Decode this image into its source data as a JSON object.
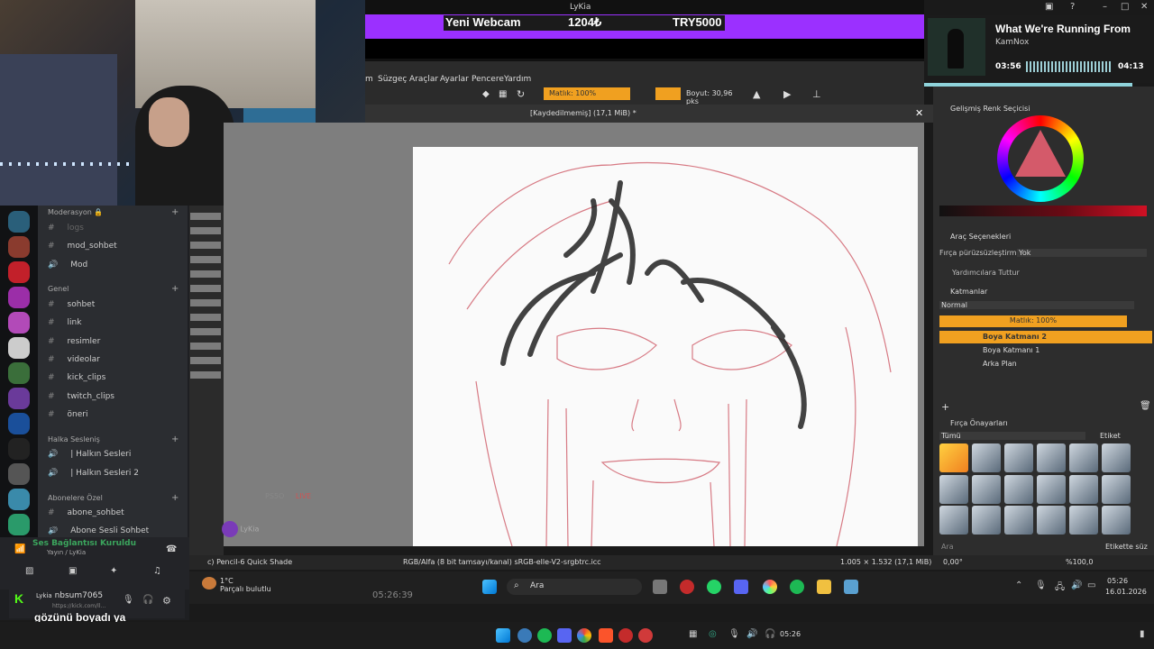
{
  "stream": {
    "streamer": "LyKia",
    "goal_label": "Yeni Webcam",
    "goal_current": "1204₺",
    "goal_target": "TRY5000"
  },
  "spotify": {
    "title": "What We're Running From",
    "artist": "KamNox",
    "time_elapsed": "03:56",
    "time_total": "04:13",
    "progress": 0.93
  },
  "krita": {
    "menu": [
      "Süzgeç",
      "Araçlar",
      "Ayarlar",
      "Pencere",
      "Yardım"
    ],
    "opacity_label": "Matlık: 100%",
    "size_label": "Boyut: 30,96 pks",
    "document_title": "[Kaydedilmemiş]  (17,1 MiB) *",
    "close": "✕",
    "status_brush": "c) Pencil-6 Quick Shade",
    "status_color": "RGB/Alfa (8 bit tamsayı/kanal)  sRGB-elle-V2-srgbtrc.icc",
    "status_size": "1.005 × 1.532 (17,1 MiB)",
    "status_angle": "0,00°",
    "status_zoom": "%100,0",
    "dockers": {
      "color_selector": "Gelişmiş Renk Seçicisi",
      "tool_options": "Araç Seçenekleri",
      "smoothing_label": "Fırça pürüzsüzleştirme:",
      "smoothing_value": "Yok",
      "snap_label": "Yardımcılara Tuttur",
      "layers": "Katmanlar",
      "blend_mode": "Normal",
      "layer_opacity": "Matlık:  100%",
      "layer_list": [
        "Boya Katmanı 2",
        "Boya Katmanı 1",
        "Arka Plan"
      ],
      "brush_presets": "Fırça Önayarları",
      "brush_filter": "Tümü",
      "tag_label": "Etiket",
      "search_placeholder": "Ara",
      "tag_filter": "Etikette süz"
    }
  },
  "discord": {
    "categories": {
      "moderation": "Moderasyon 🔒",
      "general": "Genel",
      "voice": "Halka Sesleniş",
      "subscribers": "Abonelere Özel"
    },
    "channels": {
      "logs": "logs",
      "mod_sohbet": "mod_sohbet",
      "mod": "Mod",
      "sohbet": "sohbet",
      "link": "link",
      "resimler": "resimler",
      "videolar": "videolar",
      "kick_clips": "kick_clips",
      "twitch_clips": "twitch_clips",
      "oneri": "öneri",
      "halkin_sesleri": "| Halkın Sesleri",
      "halkin_sesleri_2": "| Halkın Sesleri 2",
      "abone_sohbet": "abone_sohbet",
      "abone_sesli": "Abone Sesli Sohbet"
    },
    "voice_status": "Ses Bağlantısı Kuruldu",
    "voice_sub": "Yayın / LyKia",
    "username": "Lykia",
    "chat_user": "nbsum7065",
    "kick_url": "https://kick.com/ll...",
    "chat_message": "gözünü boyadı ya",
    "overlay_user": "LyKia",
    "vod_label": "PS5O",
    "live_badge": "LIVE"
  },
  "taskbar": {
    "weather_temp": "1°C",
    "weather_desc": "Parçalı bulutlu",
    "clock_overlay": "05:26:39",
    "search_label": "Ara",
    "tray_time": "05:26",
    "tray_date": "16.01.2026",
    "bottom_time": "05:26"
  }
}
